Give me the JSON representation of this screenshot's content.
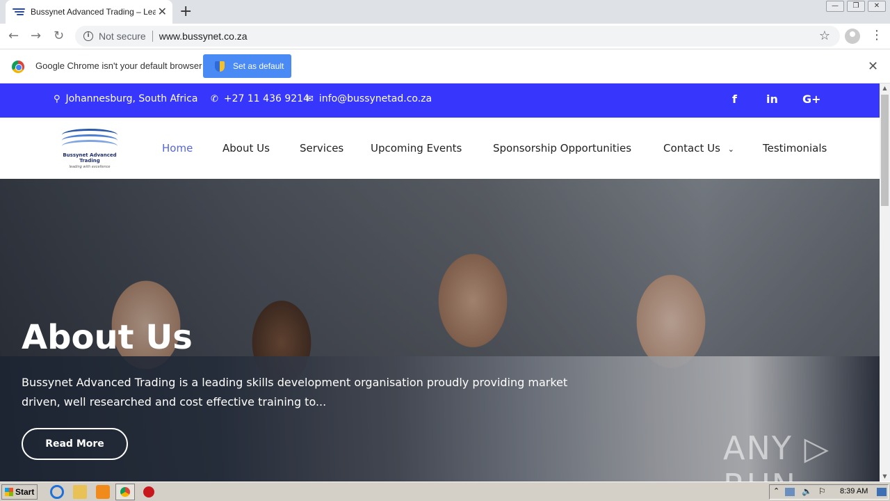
{
  "browser": {
    "tab_title": "Bussynet Advanced Trading – Leadi",
    "tab_close": "✕",
    "new_tab": "+",
    "window_buttons": [
      "—",
      "❐",
      "✕"
    ],
    "not_secure": "Not secure",
    "url": "www.bussynet.co.za"
  },
  "infobar": {
    "message": "Google Chrome isn't your default browser",
    "button_label": "Set as default",
    "close": "✕"
  },
  "topbar": {
    "location": "Johannesburg, South Africa",
    "phone": "+27 11 436 9214",
    "email": "info@bussynetad.co.za",
    "social": [
      "f",
      "in",
      "G+"
    ]
  },
  "logo": {
    "line1": "Bussynet Advanced",
    "line2": "Trading",
    "tagline": "leading with excellence"
  },
  "nav": {
    "items": [
      "Home",
      "About Us",
      "Services",
      "Upcoming Events",
      "Sponsorship Opportunities",
      "Contact Us",
      "Testimonials"
    ],
    "dropdown_indicator": "⌄"
  },
  "hero": {
    "title": "About Us",
    "text": "Bussynet Advanced Trading is a leading skills development organisation proudly providing market driven, well researched and cost effective training to...",
    "button_label": "Read More",
    "watermark": "ANY ▷ RUN"
  },
  "taskbar": {
    "start_label": "Start",
    "clock": "8:39 AM"
  },
  "colors": {
    "topbar": "#3636fc",
    "nav_active": "#5465e0",
    "set_default_button": "#4a8af4"
  }
}
